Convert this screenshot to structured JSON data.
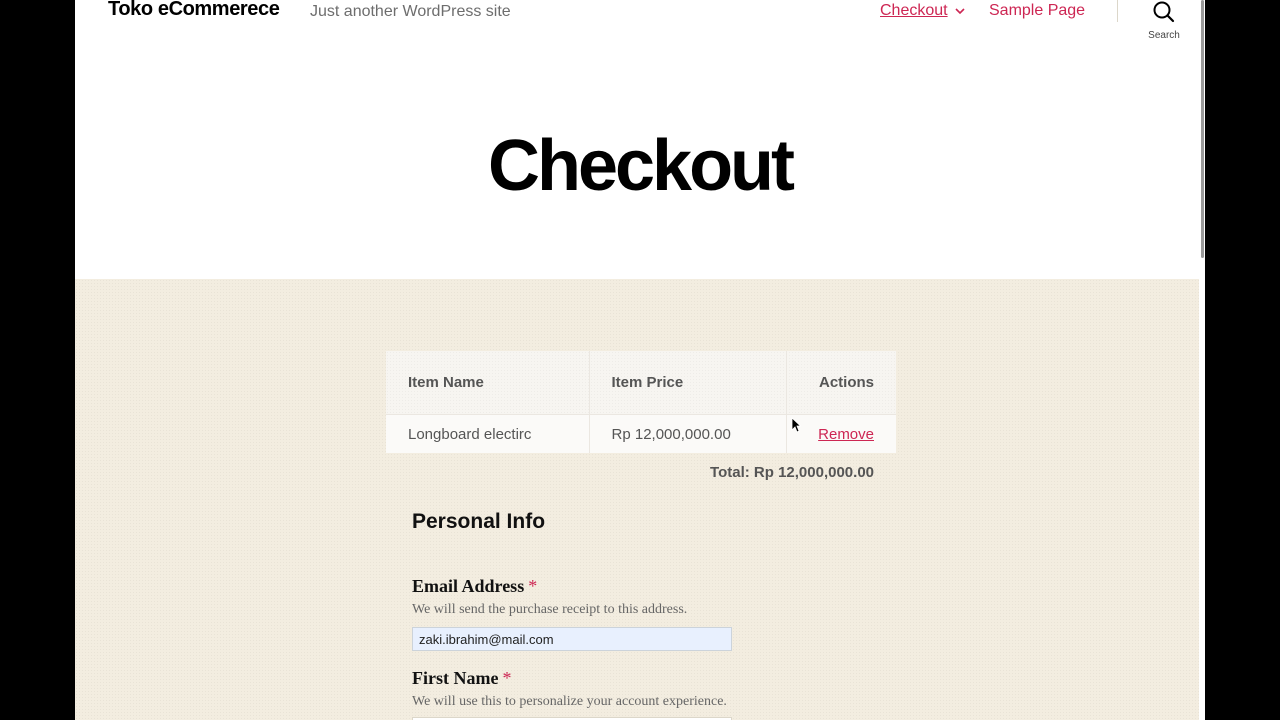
{
  "header": {
    "site_title": "Toko eCommerece",
    "site_description": "Just another WordPress site",
    "nav": {
      "checkout": "Checkout",
      "sample_page": "Sample Page"
    },
    "search_label": "Search"
  },
  "page": {
    "title": "Checkout"
  },
  "cart": {
    "columns": [
      "Item Name",
      "Item Price",
      "Actions"
    ],
    "rows": [
      {
        "name": "Longboard electirc",
        "price": "Rp 12,000,000.00",
        "action": "Remove"
      }
    ],
    "total": "Total: Rp 12,000,000.00"
  },
  "personal_info": {
    "title": "Personal Info",
    "email": {
      "label": "Email Address",
      "required": "*",
      "description": "We will send the purchase receipt to this address.",
      "value": "zaki.ibrahim@mail.com"
    },
    "first_name": {
      "label": "First Name",
      "required": "*",
      "description": "We will use this to personalize your account experience.",
      "value": ""
    }
  },
  "colors": {
    "accent": "#cd2653",
    "content_background": "#f3ede0"
  },
  "icons": {
    "nav_dropdown": "chevron-down-icon",
    "search": "search-icon",
    "cursor": "mouse-pointer-icon"
  }
}
